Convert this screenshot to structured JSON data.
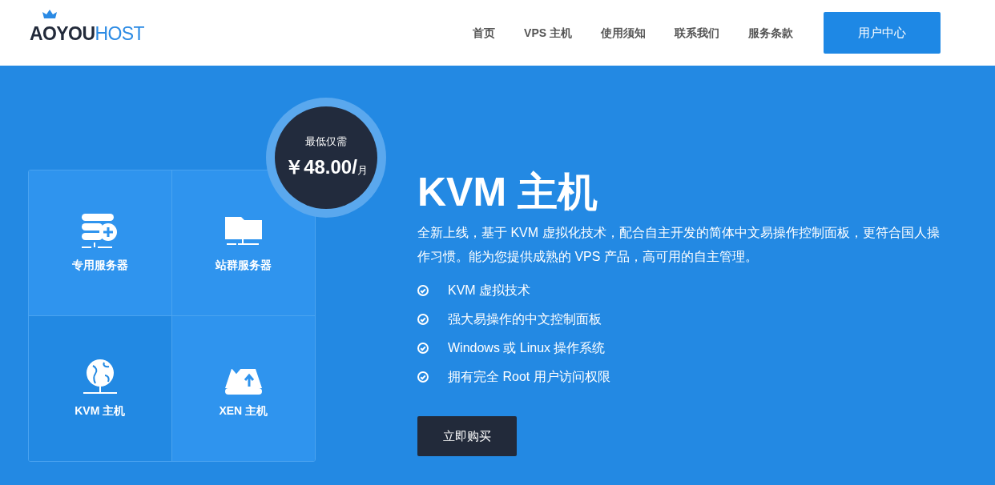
{
  "header": {
    "logo": {
      "dark": "AOYOU",
      "accent": "HOST"
    },
    "nav": [
      {
        "label": "首页"
      },
      {
        "label": "VPS 主机"
      },
      {
        "label": "使用须知"
      },
      {
        "label": "联系我们"
      },
      {
        "label": "服务条款"
      }
    ],
    "user_center_button": "用户中心"
  },
  "price_badge": {
    "caption": "最低仅需",
    "price": "￥48.00/",
    "unit": "月"
  },
  "tiles": [
    {
      "kind": "server",
      "label": "专用服务器",
      "selected": false
    },
    {
      "kind": "folder",
      "label": "站群服务器",
      "selected": false
    },
    {
      "kind": "globe",
      "label": "KVM 主机",
      "selected": true
    },
    {
      "kind": "drive",
      "label": "XEN 主机",
      "selected": false
    }
  ],
  "hero": {
    "title": "KVM 主机",
    "description": "全新上线，基于 KVM 虚拟化技术，配合自主开发的简体中文易操作控制面板，更符合国人操作习惯。能为您提供成熟的 VPS 产品，高可用的自主管理。",
    "features": [
      "KVM 虚拟技术",
      "强大易操作的中文控制面板",
      "Windows 或 Linux 操作系统",
      "拥有完全 Root 用户访问权限"
    ],
    "buy_button": "立即购买"
  }
}
